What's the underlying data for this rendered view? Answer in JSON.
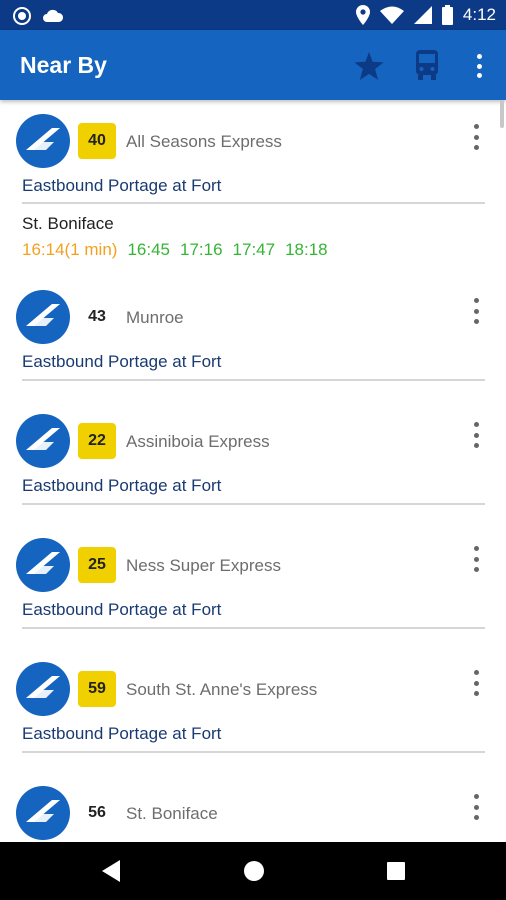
{
  "status_bar": {
    "time": "4:12",
    "icons": [
      "circle-notification-icon",
      "cloud-icon",
      "location-icon",
      "wifi-icon",
      "signal-icon",
      "battery-icon"
    ]
  },
  "app_bar": {
    "title": "Near By",
    "actions": [
      "star-icon",
      "bus-icon",
      "more-vert-icon"
    ]
  },
  "colors": {
    "status_bar": "#0d3a86",
    "app_bar": "#1565c0",
    "badge": "#f1d000",
    "stop_text": "#1a3a72",
    "next_time": "#f4a020",
    "later_times": "#35b535"
  },
  "routes": [
    {
      "number": "40",
      "badge_highlight": true,
      "name": "All Seasons Express",
      "stop": "Eastbound Portage at Fort",
      "destination": "St. Boniface",
      "next_time": "16:14(1 min)",
      "times": [
        "16:45",
        "17:16",
        "17:47",
        "18:18"
      ]
    },
    {
      "number": "43",
      "badge_highlight": false,
      "name": "Munroe",
      "stop": "Eastbound Portage at Fort"
    },
    {
      "number": "22",
      "badge_highlight": true,
      "name": "Assiniboia Express",
      "stop": "Eastbound Portage at Fort"
    },
    {
      "number": "25",
      "badge_highlight": true,
      "name": "Ness Super Express",
      "stop": "Eastbound Portage at Fort"
    },
    {
      "number": "59",
      "badge_highlight": true,
      "name": "South St. Anne's Express",
      "stop": "Eastbound Portage at Fort"
    },
    {
      "number": "56",
      "badge_highlight": false,
      "name": "St. Boniface"
    }
  ],
  "nav_bar": [
    "back-icon",
    "home-icon",
    "recents-icon"
  ]
}
